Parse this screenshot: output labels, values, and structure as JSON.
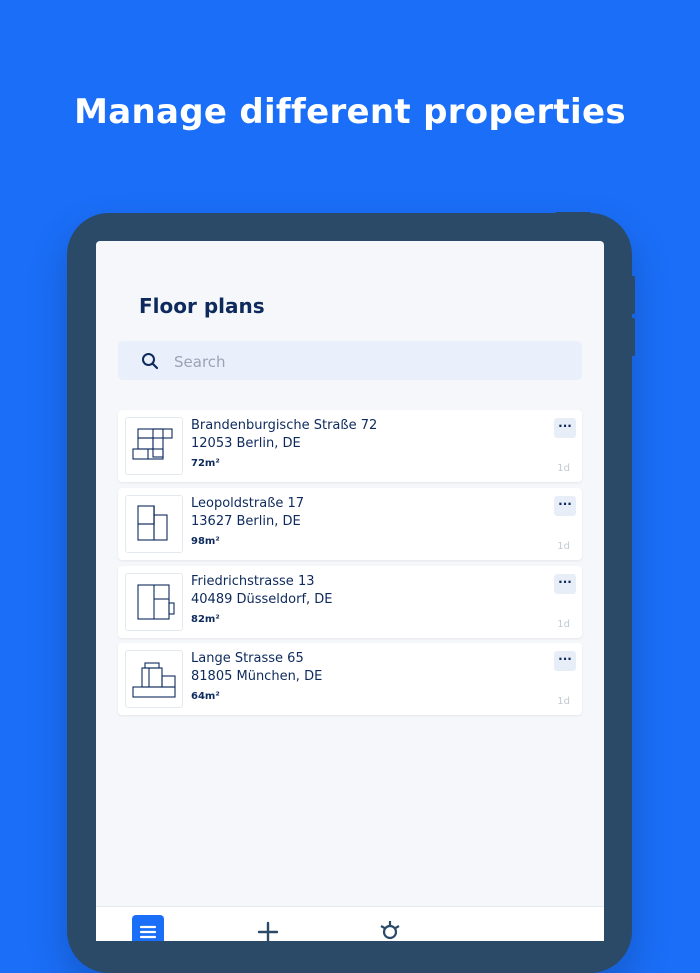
{
  "headline": "Manage different properties",
  "screen": {
    "title": "Floor plans",
    "search": {
      "placeholder": "Search",
      "value": ""
    },
    "properties": [
      {
        "street": "Brandenburgische Straße 72",
        "city": "12053 Berlin, DE",
        "area": "72m²",
        "age": "1d",
        "menu_label": "···",
        "thumb_icon": "floor-plan-1"
      },
      {
        "street": "Leopoldstraße 17",
        "city": "13627 Berlin, DE",
        "area": "98m²",
        "age": "1d",
        "menu_label": "···",
        "thumb_icon": "floor-plan-2"
      },
      {
        "street": "Friedrichstrasse 13",
        "city": "40489 Düsseldorf, DE",
        "area": "82m²",
        "age": "1d",
        "menu_label": "···",
        "thumb_icon": "floor-plan-3"
      },
      {
        "street": "Lange Strasse 65",
        "city": "81805 München, DE",
        "area": "64m²",
        "age": "1d",
        "menu_label": "···",
        "thumb_icon": "floor-plan-4"
      }
    ]
  },
  "bottom_nav": [
    {
      "icon": "list-icon",
      "active": true
    },
    {
      "icon": "plus-icon",
      "active": false
    },
    {
      "icon": "gear-icon",
      "active": false
    }
  ],
  "colors": {
    "background": "#1a6ef7",
    "device": "#2a4a68",
    "text_primary": "#0e2a5c",
    "accent": "#1a6ef7"
  }
}
